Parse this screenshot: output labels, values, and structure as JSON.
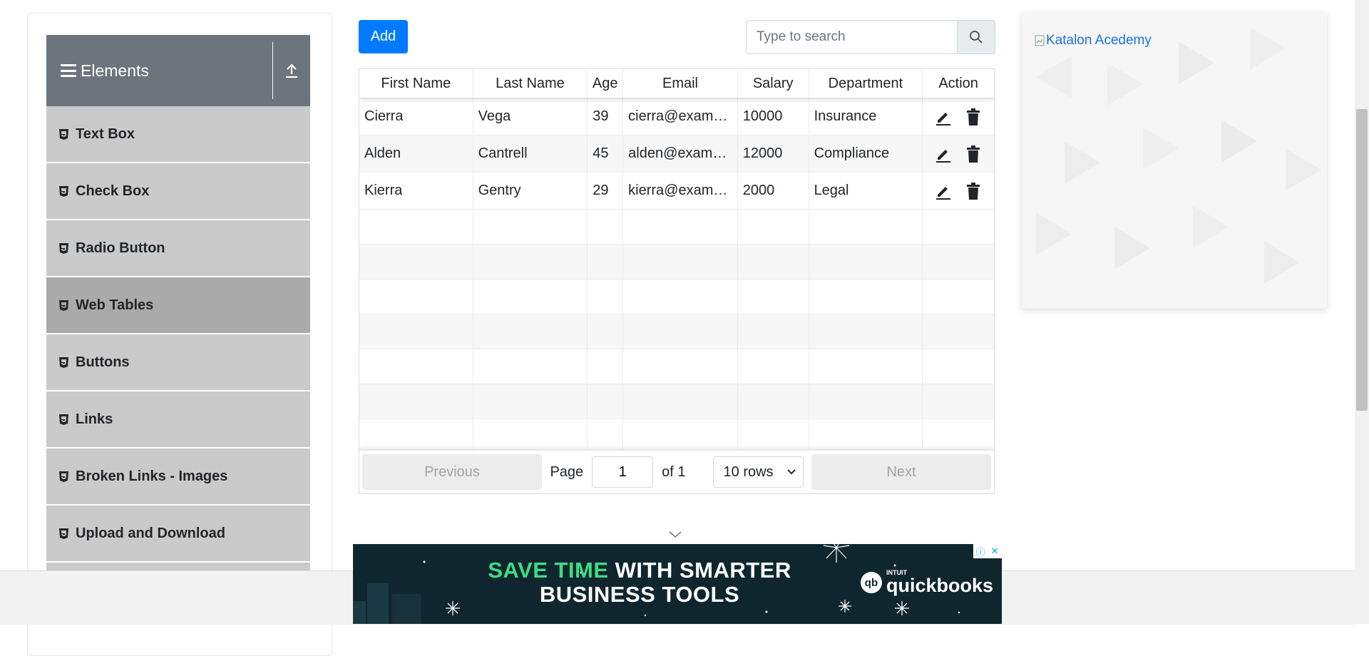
{
  "sidebar": {
    "group_title": "Elements",
    "items": [
      {
        "label": "Text Box"
      },
      {
        "label": "Check Box"
      },
      {
        "label": "Radio Button"
      },
      {
        "label": "Web Tables"
      },
      {
        "label": "Buttons"
      },
      {
        "label": "Links"
      },
      {
        "label": "Broken Links - Images"
      },
      {
        "label": "Upload and Download"
      }
    ],
    "active_item": "Web Tables"
  },
  "toolbar": {
    "add_label": "Add",
    "search_placeholder": "Type to search"
  },
  "table": {
    "headers": [
      "First Name",
      "Last Name",
      "Age",
      "Email",
      "Salary",
      "Department",
      "Action"
    ],
    "rows": [
      {
        "first": "Cierra",
        "last": "Vega",
        "age": "39",
        "email": "cierra@example.com",
        "salary": "10000",
        "department": "Insurance"
      },
      {
        "first": "Alden",
        "last": "Cantrell",
        "age": "45",
        "email": "alden@example.com",
        "salary": "12000",
        "department": "Compliance"
      },
      {
        "first": "Kierra",
        "last": "Gentry",
        "age": "29",
        "email": "kierra@example.com",
        "salary": "2000",
        "department": "Legal"
      }
    ]
  },
  "pagination": {
    "previous_label": "Previous",
    "next_label": "Next",
    "page_label": "Page",
    "page_value": "1",
    "of_label": "of 1",
    "rows_selected": "10 rows"
  },
  "right_ad": {
    "alt_text": "Katalon Acedemy"
  },
  "banner": {
    "headline_accent": "SAVE TIME",
    "headline_rest": "WITH SMARTER",
    "headline_line2": "BUSINESS TOOLS",
    "brand_small": "INTUIT",
    "brand": "quickbooks",
    "brand_mark": "qb"
  },
  "colors": {
    "primary": "#007bff",
    "sidebar_header": "#6c757d",
    "menu_bg": "#cacaca",
    "menu_active": "#aaaaaa",
    "banner_bg": "#10262e",
    "banner_accent": "#3ddc84"
  }
}
